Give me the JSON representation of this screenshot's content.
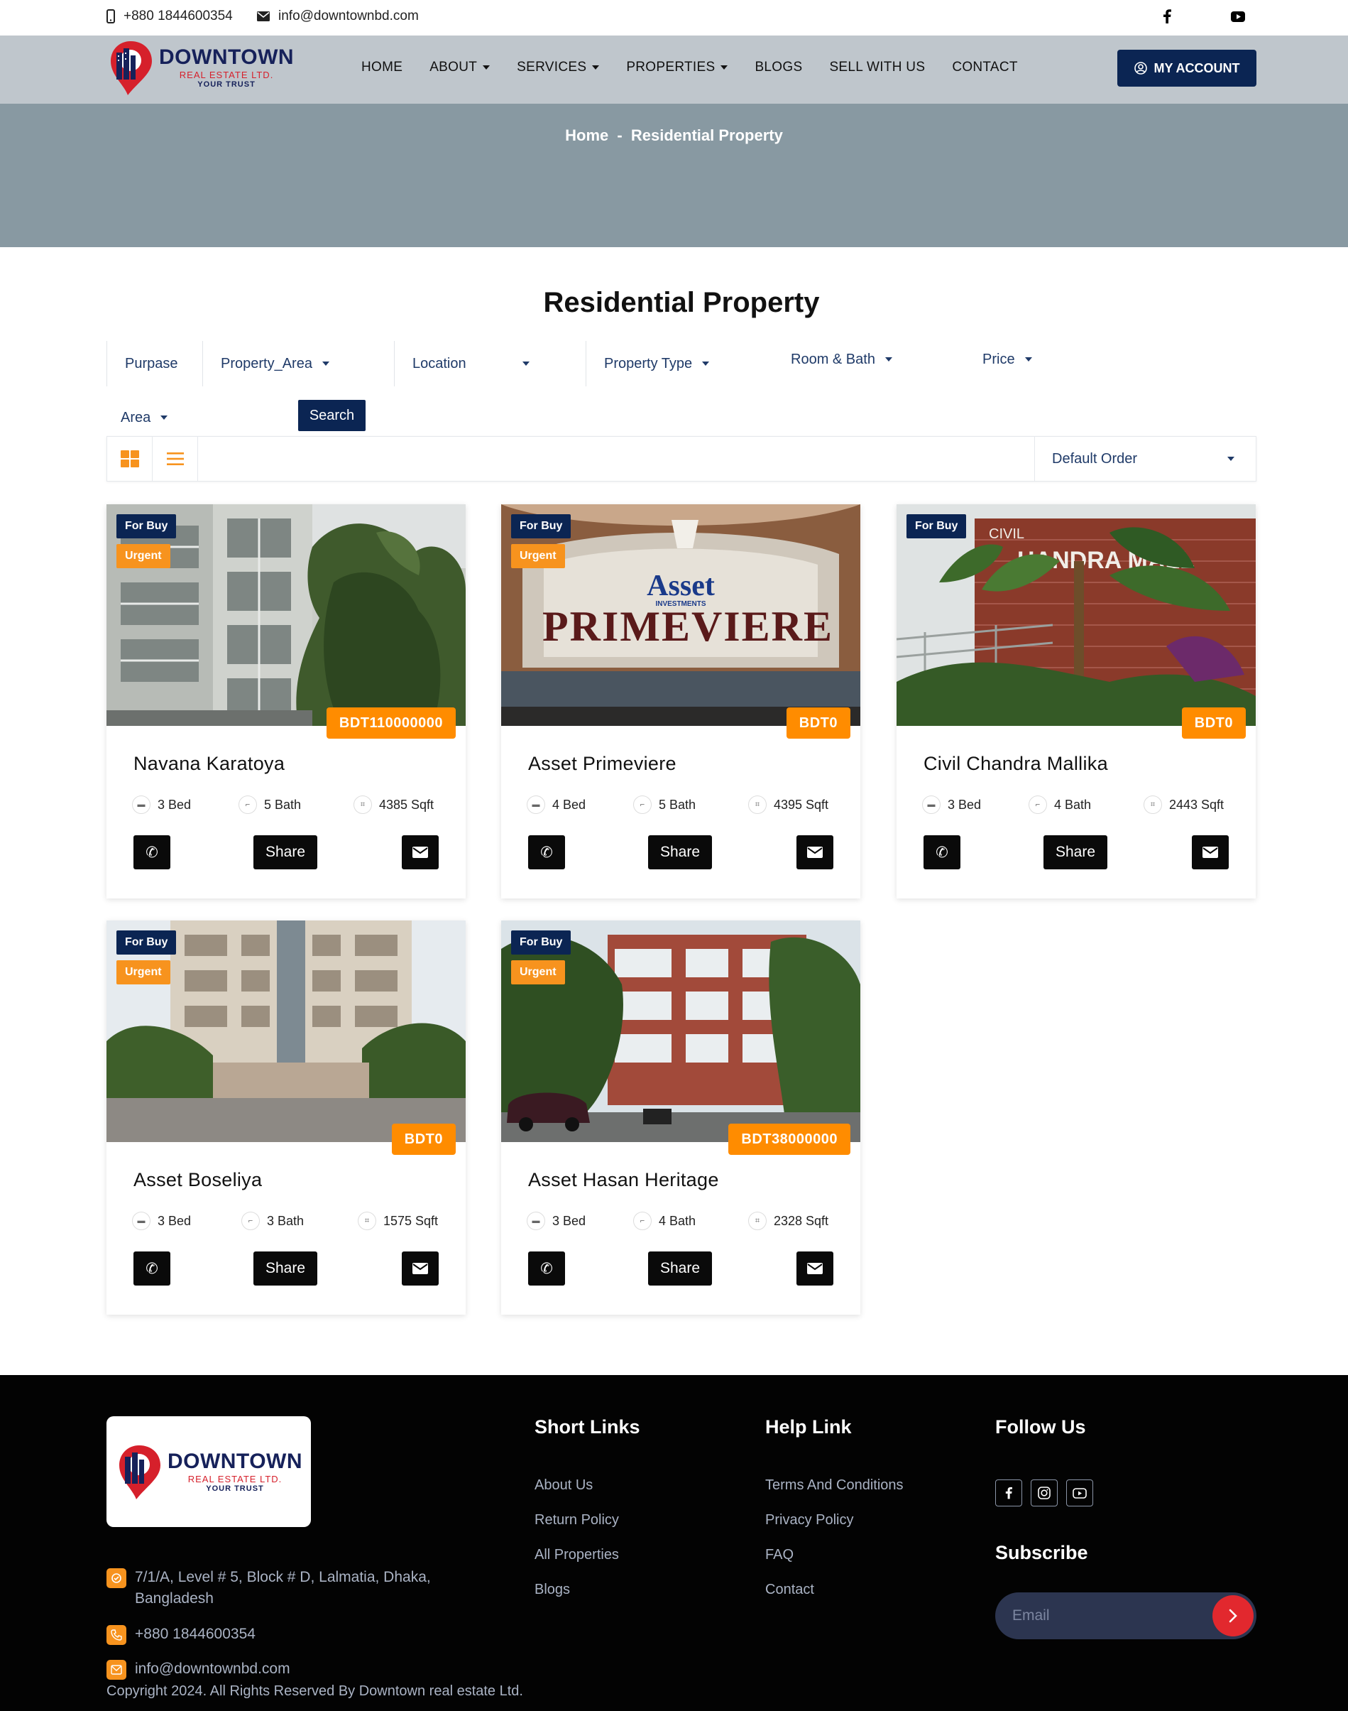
{
  "topbar": {
    "phone": "+880 1844600354",
    "email": "info@downtownbd.com"
  },
  "brand": {
    "name": "DOWNTOWN",
    "sub": "REAL ESTATE LTD.",
    "tagline": "YOUR TRUST"
  },
  "nav": {
    "items": [
      {
        "label": "HOME",
        "dropdown": false
      },
      {
        "label": "ABOUT",
        "dropdown": true
      },
      {
        "label": "SERVICES",
        "dropdown": true
      },
      {
        "label": "PROPERTIES",
        "dropdown": true
      },
      {
        "label": "BLOGS",
        "dropdown": false
      },
      {
        "label": "SELL WITH US",
        "dropdown": false
      },
      {
        "label": "CONTACT",
        "dropdown": false
      }
    ],
    "account_label": "MY ACCOUNT"
  },
  "breadcrumb": {
    "home": "Home",
    "sep": "-",
    "current": "Residential Property"
  },
  "page_title": "Residential Property",
  "filters": {
    "purpose": "Purpase",
    "property_area": "Property_Area",
    "location": "Location",
    "property_type": "Property Type",
    "room_bath": "Room & Bath",
    "price": "Price",
    "area": "Area",
    "search": "Search"
  },
  "sort": {
    "selected": "Default Order"
  },
  "cards": [
    {
      "for": "For Buy",
      "status": "Urgent",
      "price": "BDT110000000",
      "name": "Navana Karatoya",
      "bed": "3 Bed",
      "bath": "5 Bath",
      "size": "4385 Sqft",
      "share": "Share"
    },
    {
      "for": "For Buy",
      "status": "Urgent",
      "price": "BDT0",
      "name": "Asset Primeviere",
      "bed": "4 Bed",
      "bath": "5 Bath",
      "size": "4395 Sqft",
      "share": "Share",
      "sign_top": "Asset",
      "sign_mid": "INVESTMENTS",
      "sign_text": "PRIMEVIERE"
    },
    {
      "for": "For Buy",
      "status": null,
      "price": "BDT0",
      "name": "Civil Chandra Mallika",
      "bed": "3 Bed",
      "bath": "4 Bath",
      "size": "2443 Sqft",
      "share": "Share",
      "sign_text": "CIVIL",
      "sign_text2": "HANDRA MALL"
    },
    {
      "for": "For Buy",
      "status": "Urgent",
      "price": "BDT0",
      "name": "Asset Boseliya",
      "bed": "3 Bed",
      "bath": "3 Bath",
      "size": "1575 Sqft",
      "share": "Share"
    },
    {
      "for": "For Buy",
      "status": "Urgent",
      "price": "BDT38000000",
      "name": "Asset Hasan Heritage",
      "bed": "3 Bed",
      "bath": "4 Bath",
      "size": "2328 Sqft",
      "share": "Share"
    }
  ],
  "footer": {
    "address": "7/1/A, Level # 5, Block # D, Lalmatia, Dhaka, Bangladesh",
    "phone": "+880 1844600354",
    "email": "info@downtownbd.com",
    "short_links": {
      "title": "Short Links",
      "items": [
        "About Us",
        "Return Policy",
        "All Properties",
        "Blogs"
      ]
    },
    "help_links": {
      "title": "Help Link",
      "items": [
        "Terms And Conditions",
        "Privacy Policy",
        "FAQ",
        "Contact"
      ]
    },
    "follow": {
      "title": "Follow Us"
    },
    "subscribe": {
      "title": "Subscribe",
      "placeholder": "Email"
    },
    "copyright": "Copyright 2024. All Rights Reserved By Downtown real estate Ltd."
  },
  "colors": {
    "navy": "#0b2553",
    "orange": "#ff8c00",
    "red": "#e2282e"
  }
}
